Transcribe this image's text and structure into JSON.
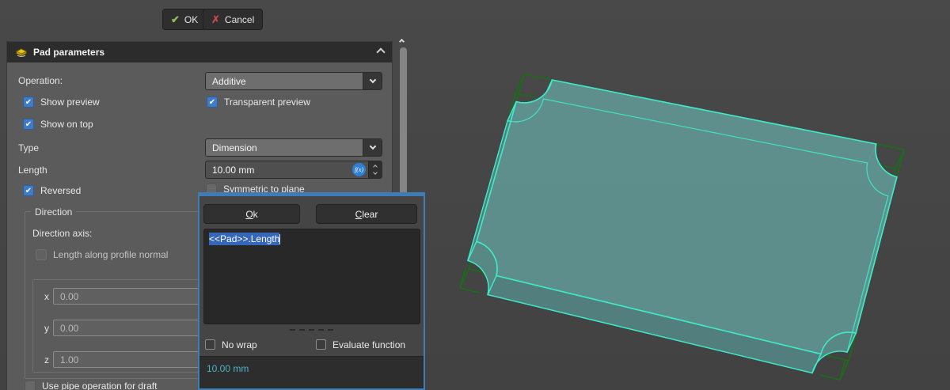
{
  "task_buttons": {
    "ok_label": "OK",
    "cancel_label": "Cancel"
  },
  "icons": {
    "ok_glyph": "✔",
    "cancel_glyph": "✗",
    "check": "✔"
  },
  "panel": {
    "title": "Pad parameters",
    "operation_label": "Operation:",
    "operation_value": "Additive",
    "show_preview": "Show preview",
    "transparent_preview": "Transparent preview",
    "show_on_top": "Show on top",
    "type_label": "Type",
    "type_value": "Dimension",
    "length_label": "Length",
    "length_value": "10.00 mm",
    "fx_badge": "f(x)",
    "reversed": "Reversed",
    "symmetric": "Symmetric to plane",
    "use_pipe": "Use pipe operation for draft",
    "direction": {
      "group_label": "Direction",
      "axis_label": "Direction axis:",
      "along_normal": "Length along profile normal",
      "x_label": "x",
      "x_value": "0.00",
      "y_label": "y",
      "y_value": "0.00",
      "z_label": "z",
      "z_value": "1.00"
    }
  },
  "popup": {
    "ok_button": {
      "accel": "O",
      "rest": "k"
    },
    "clear_button": {
      "accel": "C",
      "rest": "lear"
    },
    "expression": "<<Pad>>.Length",
    "no_wrap": "No wrap",
    "evaluate_function": "Evaluate function",
    "result": "10.00 mm"
  },
  "viewport": {
    "preview_edge_color": "#3debc7",
    "sketch_edge_color": "#1b6b1b",
    "face_top_color": "#5f928f",
    "face_side_color": "#527f7d",
    "face_corner_color": "#578884"
  }
}
